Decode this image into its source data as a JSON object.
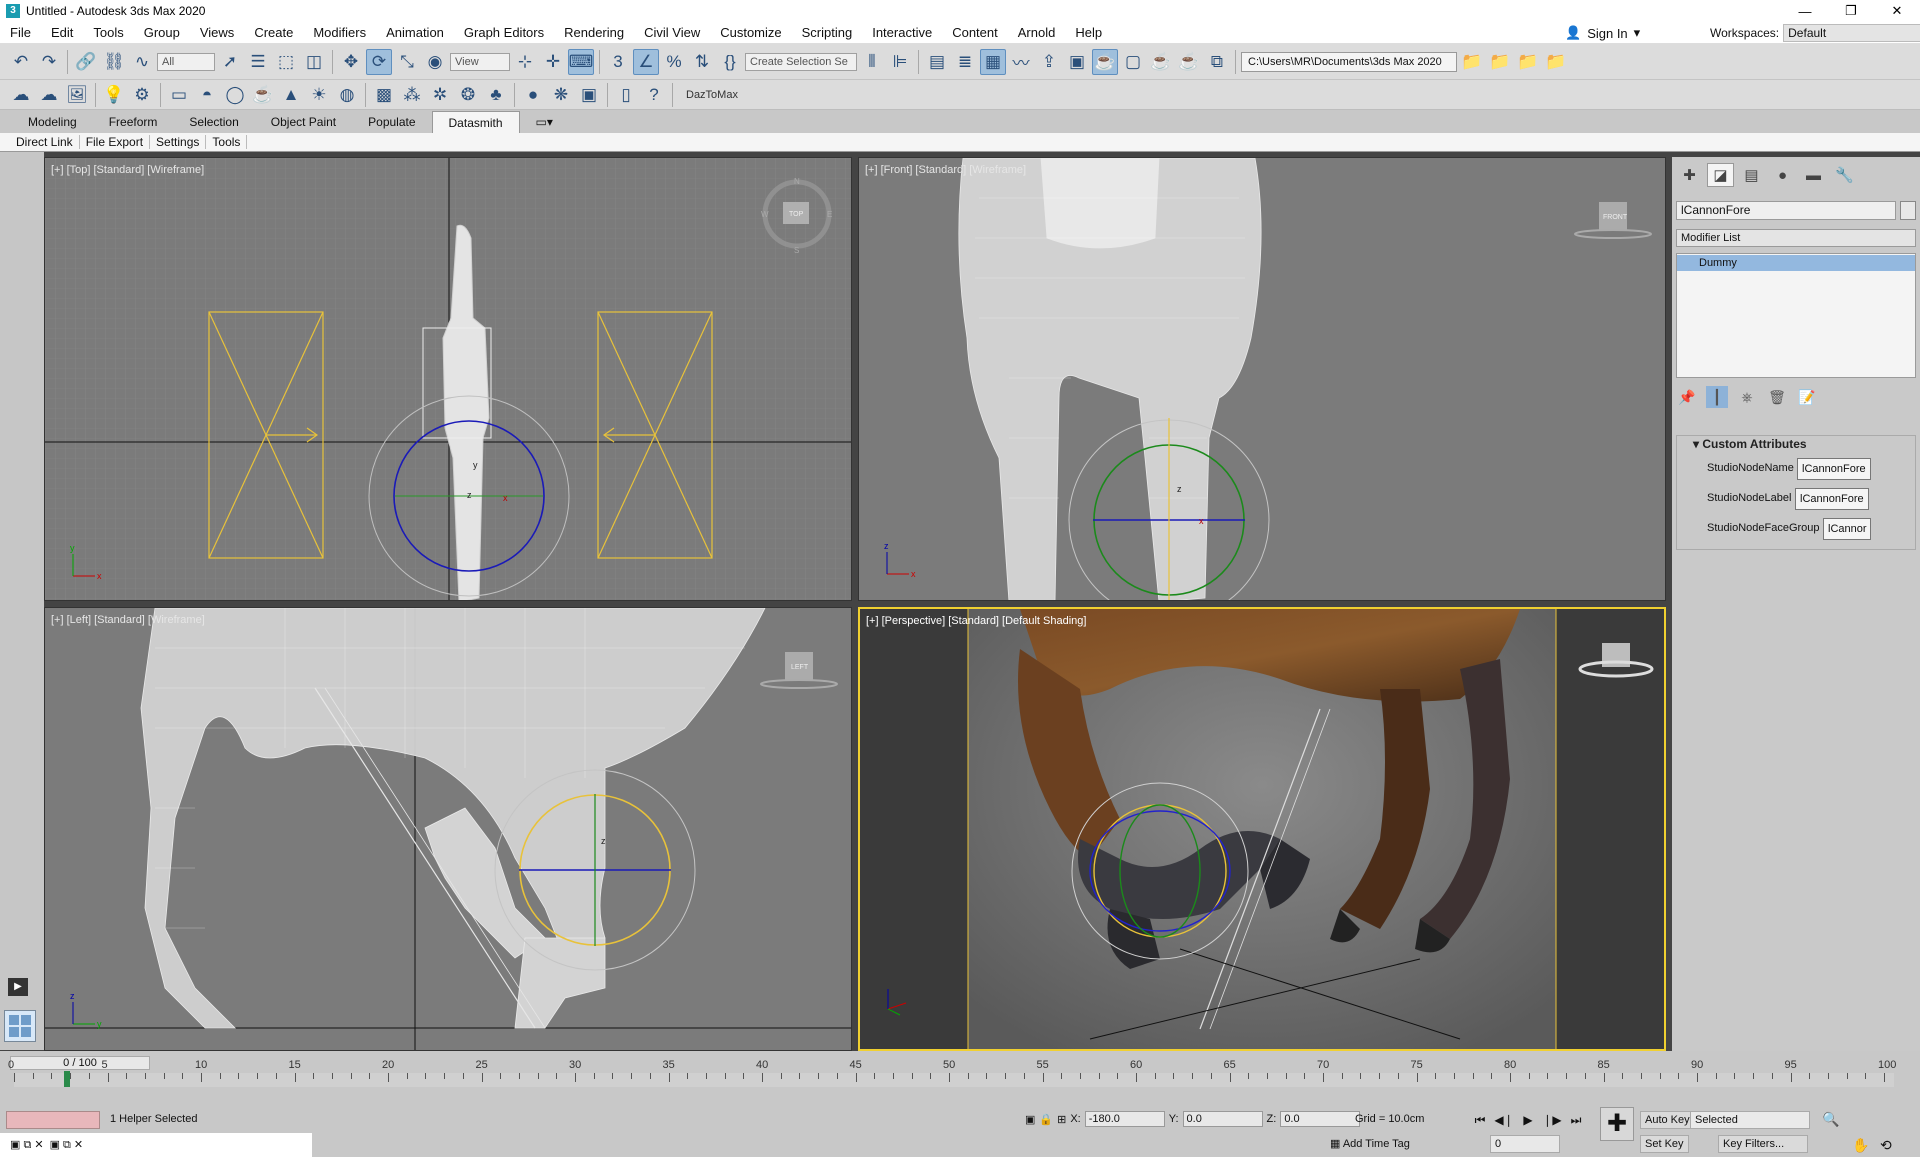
{
  "window": {
    "title": "Untitled - Autodesk 3ds Max 2020",
    "min": "—",
    "restore": "❐",
    "close": "✕"
  },
  "menu": [
    "File",
    "Edit",
    "Tools",
    "Group",
    "Views",
    "Create",
    "Modifiers",
    "Animation",
    "Graph Editors",
    "Rendering",
    "Civil View",
    "Customize",
    "Scripting",
    "Interactive",
    "Content",
    "Arnold",
    "Help"
  ],
  "account": {
    "sign_in": "Sign In",
    "workspaces_label": "Workspaces:",
    "workspace": "Default"
  },
  "toolbar1": {
    "filter": "All",
    "ref_coord": "View",
    "selection_set": "Create Selection Se",
    "project_path": "C:\\Users\\MR\\Documents\\3ds Max 2020"
  },
  "toolbar2": {
    "plugin_label": "DazToMax"
  },
  "ribbon": {
    "tabs": [
      "Modeling",
      "Freeform",
      "Selection",
      "Object Paint",
      "Populate",
      "Datasmith"
    ],
    "active": "Datasmith"
  },
  "subtabs": [
    "Direct Link",
    "File Export",
    "Settings",
    "Tools"
  ],
  "viewports": {
    "top": "[+] [Top] [Standard] [Wireframe]",
    "front": "[+] [Front] [Standard] [Wireframe]",
    "left": "[+] [Left] [Standard] [Wireframe]",
    "perspective": "[+] [Perspective] [Standard] [Default Shading]",
    "cube_top": "TOP",
    "cube_front": "FRONT",
    "cube_left": "LEFT"
  },
  "command_panel": {
    "object_name": "lCannonFore",
    "modifier_list": "Modifier List",
    "stack_item": "Dummy",
    "rollout_title": "Custom Attributes",
    "attributes": [
      {
        "label": "StudioNodeName",
        "value": "lCannonFore"
      },
      {
        "label": "StudioNodeLabel",
        "value": "lCannonFore"
      },
      {
        "label": "StudioNodeFaceGroup",
        "value": "lCannor"
      }
    ]
  },
  "timeline": {
    "frame": "0 / 100",
    "ticks": [
      "0",
      "5",
      "10",
      "15",
      "20",
      "25",
      "30",
      "35",
      "40",
      "45",
      "50",
      "55",
      "60",
      "65",
      "70",
      "75",
      "80",
      "85",
      "90",
      "95",
      "100"
    ]
  },
  "status": {
    "selection": "1 Helper Selected",
    "x_label": "X:",
    "x": "-180.0",
    "y_label": "Y:",
    "y": "0.0",
    "z_label": "Z:",
    "z": "0.0",
    "grid": "Grid = 10.0cm",
    "add_time_tag": "Add Time Tag",
    "auto_key": "Auto Key",
    "set_key": "Set Key",
    "selected": "Selected",
    "key_filters": "Key Filters...",
    "current_frame": "0"
  },
  "colors": {
    "viewport_bg": "#7b7b7b",
    "active_border": "#f0d030",
    "stack_highlight": "#93b8df"
  }
}
